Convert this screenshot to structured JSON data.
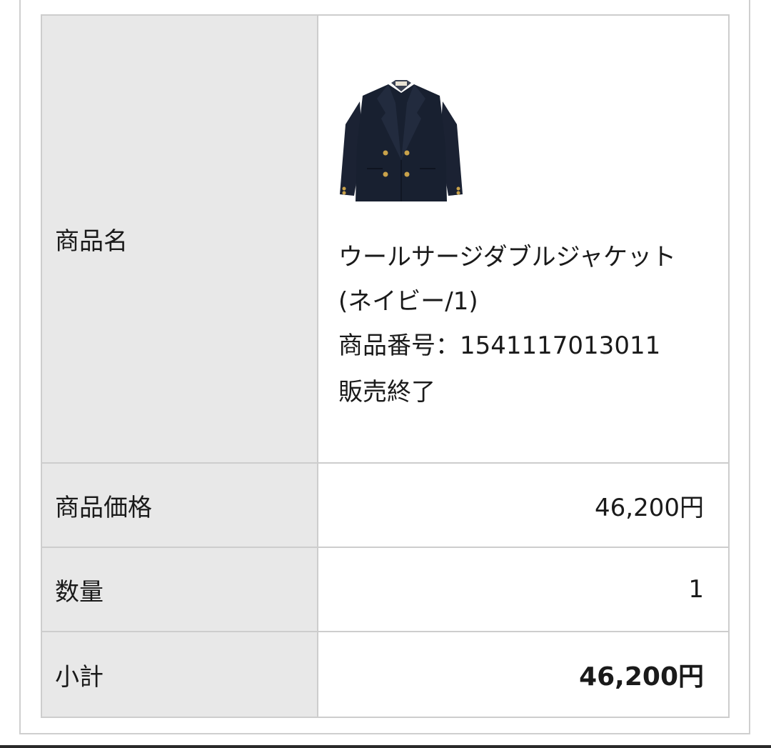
{
  "order_table": {
    "rows": {
      "product_name": {
        "label": "商品名",
        "title": "ウールサージダブルジャケット (ネイビー/1)",
        "number_label": "商品番号：",
        "number_value": "1541117013011",
        "status": "販売終了",
        "image_icon": "navy-double-breasted-jacket-image"
      },
      "price": {
        "label": "商品価格",
        "value": "46,200円"
      },
      "quantity": {
        "label": "数量",
        "value": "1"
      },
      "subtotal": {
        "label": "小計",
        "value": "46,200円"
      }
    }
  },
  "colors": {
    "label_bg": "#e8e8e8",
    "border": "#cdcdcd",
    "text": "#1a1a1a",
    "jacket": "#1b2233",
    "buttons": "#c9a24a"
  }
}
